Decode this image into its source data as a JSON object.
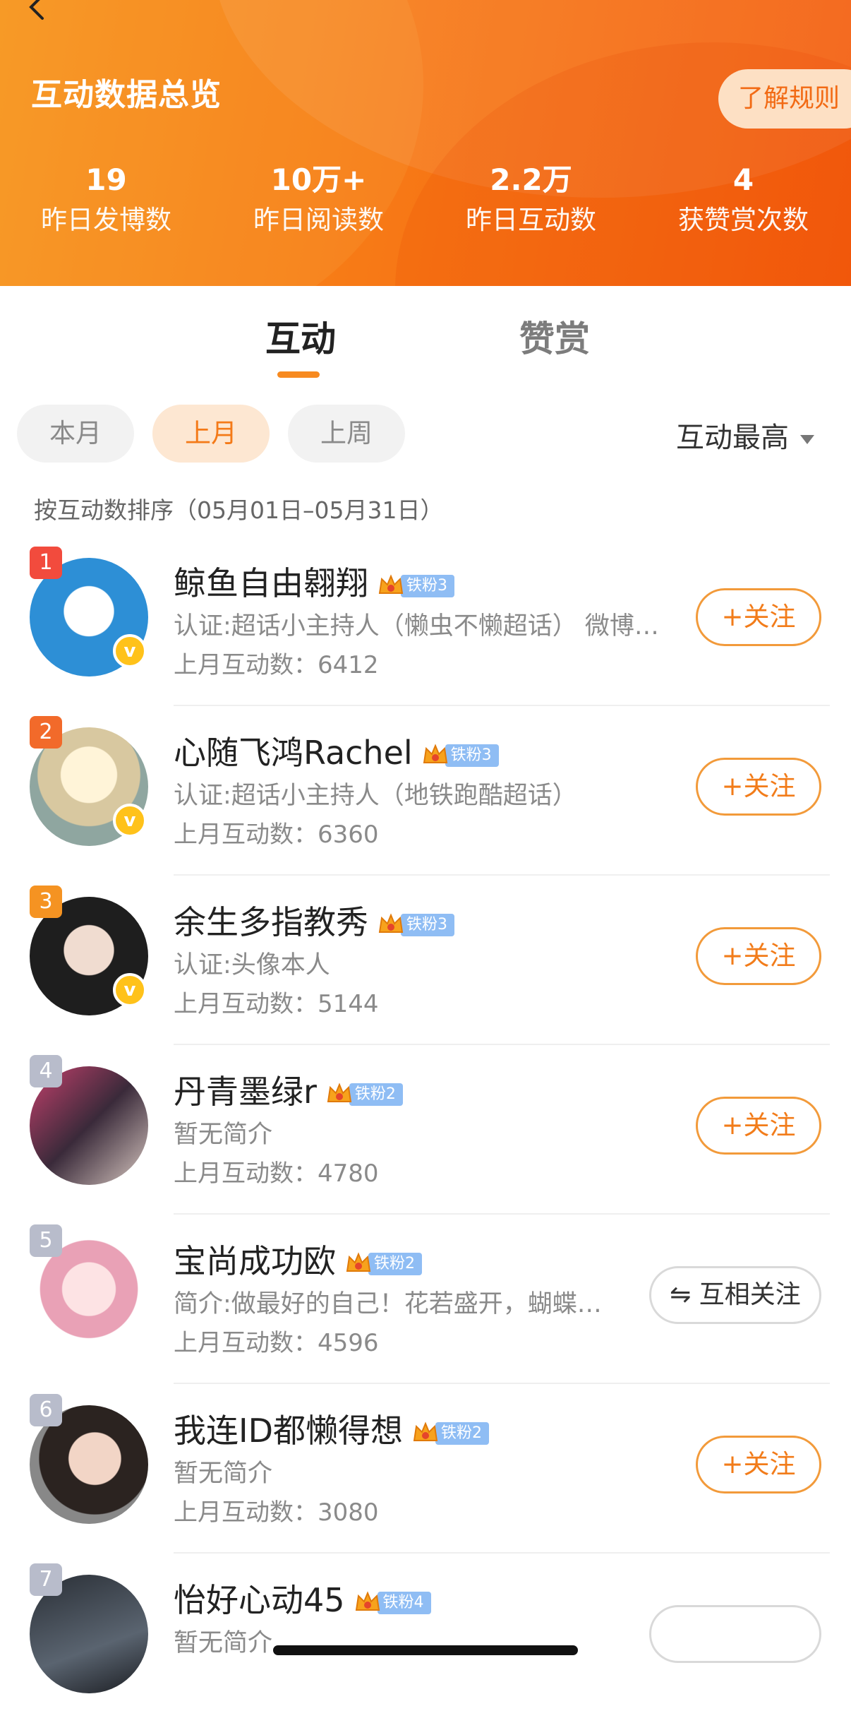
{
  "header": {
    "title": "互动数据总览",
    "rules_label": "了解规则",
    "stats": [
      {
        "value": "19",
        "label": "昨日发博数"
      },
      {
        "value": "10万+",
        "label": "昨日阅读数"
      },
      {
        "value": "2.2万",
        "label": "昨日互动数"
      },
      {
        "value": "4",
        "label": "获赞赏次数"
      }
    ]
  },
  "tabs": [
    {
      "label": "互动",
      "active": true
    },
    {
      "label": "赞赏",
      "active": false
    }
  ],
  "periods": [
    {
      "label": "本月",
      "active": false
    },
    {
      "label": "上月",
      "active": true
    },
    {
      "label": "上周",
      "active": false
    }
  ],
  "sort": {
    "selected": "互动最高"
  },
  "sort_desc": "按互动数排序（05月01日–05月31日）",
  "users": [
    {
      "rank": "1",
      "name": "鲸鱼自由翱翔",
      "fan_level": "铁粉3",
      "bio": "认证:超话小主持人（懒虫不懒超话） 微博…",
      "count": "上月互动数：6412",
      "button": "+关注",
      "verified": true
    },
    {
      "rank": "2",
      "name": "心随飞鸿Rachel",
      "fan_level": "铁粉3",
      "bio": "认证:超话小主持人（地铁跑酷超话）",
      "count": "上月互动数：6360",
      "button": "+关注",
      "verified": true
    },
    {
      "rank": "3",
      "name": "余生多指教秀",
      "fan_level": "铁粉3",
      "bio": "认证:头像本人",
      "count": "上月互动数：5144",
      "button": "+关注",
      "verified": true
    },
    {
      "rank": "4",
      "name": "丹青墨绿r",
      "fan_level": "铁粉2",
      "bio": "暂无简介",
      "count": "上月互动数：4780",
      "button": "+关注",
      "verified": false
    },
    {
      "rank": "5",
      "name": "宝尚成功欧",
      "fan_level": "铁粉2",
      "bio": "简介:做最好的自己！花若盛开，蝴蝶…",
      "count": "上月互动数：4596",
      "button": "互相关注",
      "verified": false
    },
    {
      "rank": "6",
      "name": "我连ID都懒得想",
      "fan_level": "铁粉2",
      "bio": "暂无简介",
      "count": "上月互动数：3080",
      "button": "+关注",
      "verified": false
    },
    {
      "rank": "7",
      "name": "怡好心动45",
      "fan_level": "铁粉4",
      "bio": "暂无简介",
      "count": "",
      "button": "",
      "verified": false
    }
  ],
  "colors": {
    "accent": "#f77a16",
    "rank_top": [
      "#f24b3d",
      "#f26a2a",
      "#f59322"
    ],
    "rank_other": "#b8bccb",
    "fan_tag": "#8fbdf4"
  },
  "icons": {
    "back": "chevron-left-icon",
    "crown": "crown-icon",
    "verified": "verified-v-icon",
    "mutual": "mutual-follow-icon"
  }
}
